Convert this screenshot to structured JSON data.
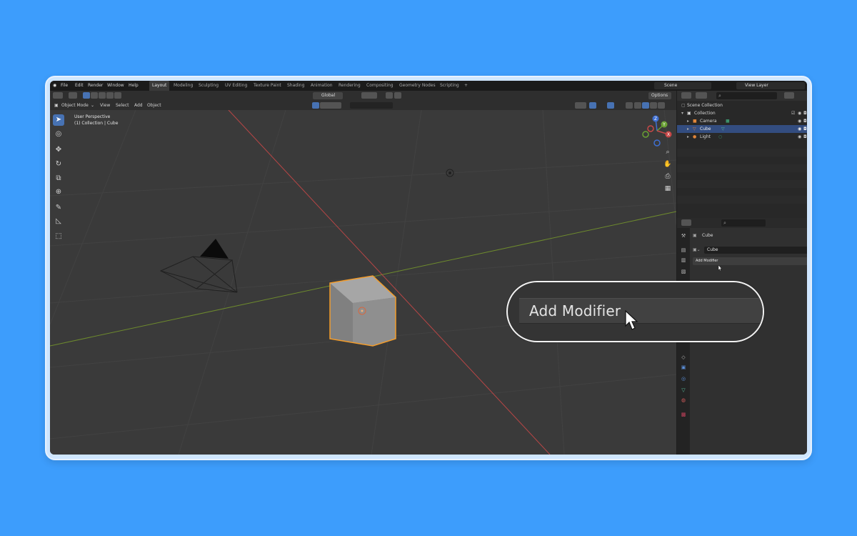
{
  "menu": {
    "items": [
      "File",
      "Edit",
      "Render",
      "Window",
      "Help"
    ],
    "workspaces": [
      "Layout",
      "Modeling",
      "Sculpting",
      "UV Editing",
      "Texture Paint",
      "Shading",
      "Animation",
      "Rendering",
      "Compositing",
      "Geometry Nodes",
      "Scripting"
    ],
    "active_workspace": "Layout",
    "add_tab": "+",
    "scene": "Scene",
    "view_layer": "View Layer"
  },
  "viewport_header": {
    "transform_orientation": "Global",
    "options": "Options",
    "mode": "Object Mode",
    "menus": [
      "View",
      "Select",
      "Add",
      "Object"
    ]
  },
  "viewport": {
    "perspective": "User Perspective",
    "collection_info": "(1) Collection | Cube",
    "gizmo_axes": [
      "Z",
      "Y",
      "X"
    ]
  },
  "outliner": {
    "root": "Scene Collection",
    "collection": "Collection",
    "objects": [
      {
        "name": "Camera",
        "selected": false
      },
      {
        "name": "Cube",
        "selected": true
      },
      {
        "name": "Light",
        "selected": false
      }
    ]
  },
  "properties": {
    "object_name": "Cube",
    "modifier_target": "Cube",
    "add_modifier": "Add Modifier"
  },
  "callout": {
    "label": "Add Modifier"
  },
  "colors": {
    "background": "#3d9dfc",
    "selection": "#4772b3",
    "cube_outline": "#f39c2b",
    "x_axis": "#b84646",
    "y_axis": "#6e8b2d"
  }
}
